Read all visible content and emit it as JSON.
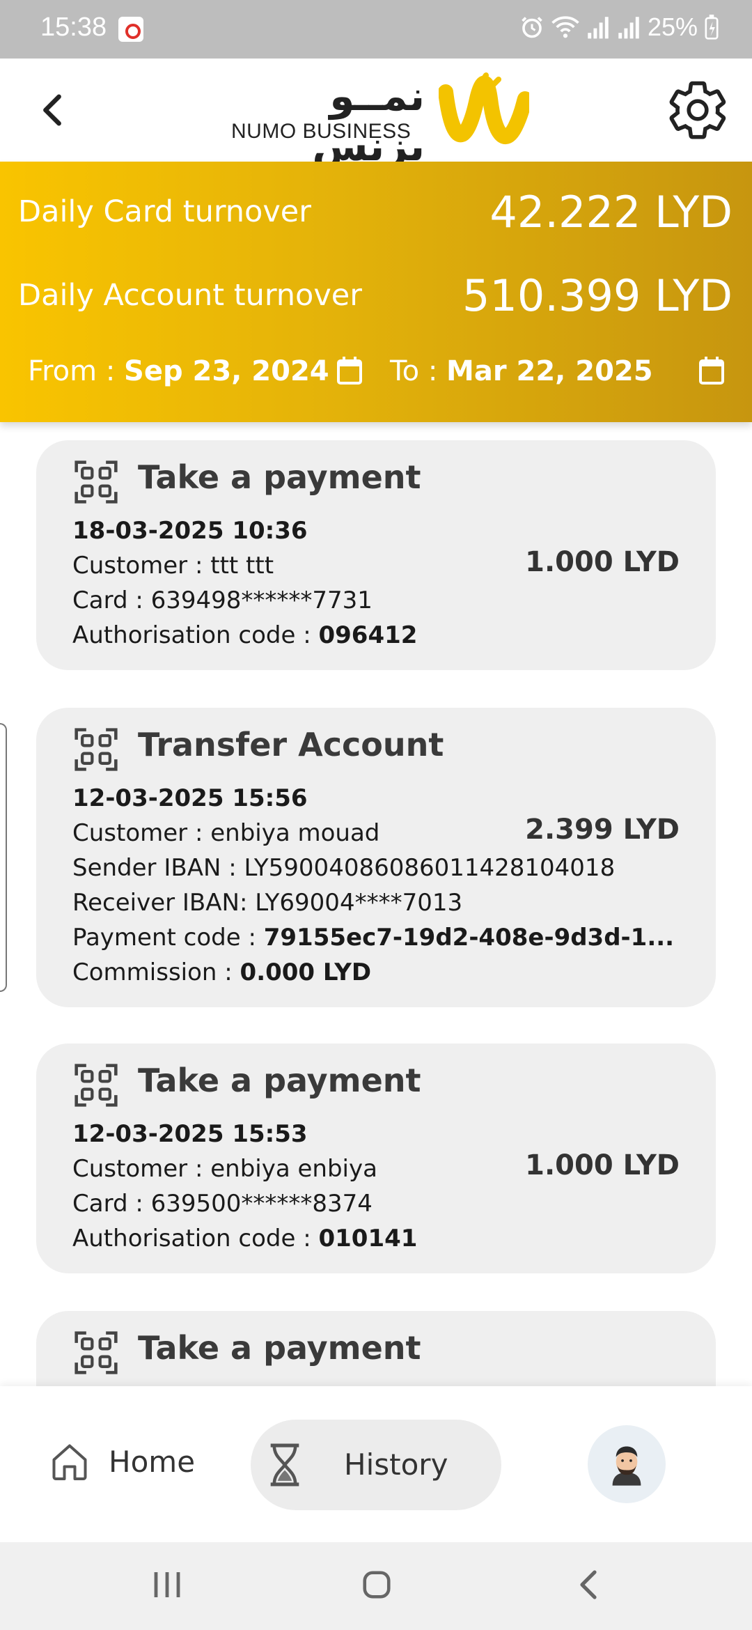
{
  "status_bar": {
    "time": "15:38",
    "battery": "25%"
  },
  "header": {
    "logo_arabic": "نمــو بزنس",
    "logo_english": "NUMO BUSINESS"
  },
  "summary": {
    "card_turnover_label": "Daily Card turnover",
    "card_turnover_value": "42.222 LYD",
    "account_turnover_label": "Daily Account turnover",
    "account_turnover_value": "510.399 LYD",
    "from_label": "From :",
    "from_date": "Sep 23, 2024",
    "to_label": "To :",
    "to_date": "Mar 22, 2025"
  },
  "transactions": [
    {
      "title": "Take a payment",
      "datetime": "18-03-2025 10:36",
      "customer_label": "Customer :",
      "customer": "ttt ttt",
      "card_label": "Card :",
      "card": "639498******7731",
      "auth_label": "Authorisation code :",
      "auth_code": "096412",
      "amount": "1.000 LYD"
    },
    {
      "title": "Transfer Account",
      "datetime": "12-03-2025 15:56",
      "customer_label": "Customer :",
      "customer": "enbiya mouad",
      "sender_label": "Sender IBAN :",
      "sender_iban": "LY59004086086011428104018",
      "receiver_label": "Receiver IBAN:",
      "receiver_iban": "LY69004****7013",
      "payment_code_label": "Payment code :",
      "payment_code": "79155ec7-19d2-408e-9d3d-1...",
      "commission_label": "Commission :",
      "commission": "0.000 LYD",
      "amount": "2.399 LYD"
    },
    {
      "title": "Take a payment",
      "datetime": "12-03-2025 15:53",
      "customer_label": "Customer :",
      "customer": "enbiya enbiya",
      "card_label": "Card :",
      "card": "639500******8374",
      "auth_label": "Authorisation code :",
      "auth_code": "010141",
      "amount": "1.000 LYD"
    },
    {
      "title": "Take a payment"
    }
  ],
  "bottom_nav": {
    "home_label": "Home",
    "history_label": "History"
  },
  "colors": {
    "brand_yellow": "#f9c400",
    "brand_gold": "#c7960f",
    "card_bg": "#efefef"
  }
}
